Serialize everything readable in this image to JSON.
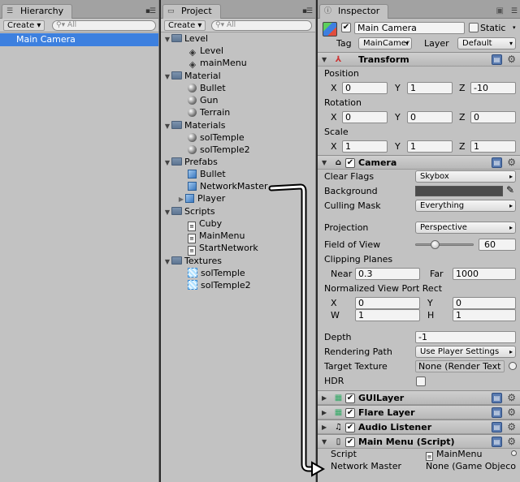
{
  "hierarchy": {
    "tab_label": "Hierarchy",
    "create_label": "Create ▾",
    "search_placeholder": "All",
    "items": [
      "Main Camera"
    ]
  },
  "project": {
    "tab_label": "Project",
    "create_label": "Create ▾",
    "search_placeholder": "All",
    "tree": {
      "level_folder": "Level",
      "level_items": [
        "Level",
        "mainMenu"
      ],
      "material_folder": "Material",
      "material_items": [
        "Bullet",
        "Gun",
        "Terrain"
      ],
      "materials_folder": "Materials",
      "materials_items": [
        "solTemple",
        "solTemple2"
      ],
      "prefabs_folder": "Prefabs",
      "prefabs_items": [
        "Bullet",
        "NetworkMaster",
        "Player"
      ],
      "scripts_folder": "Scripts",
      "scripts_items": [
        "Cuby",
        "MainMenu",
        "StartNetwork"
      ],
      "textures_folder": "Textures",
      "textures_items": [
        "solTemple",
        "solTemple2"
      ]
    }
  },
  "inspector": {
    "tab_label": "Inspector",
    "object_name": "Main Camera",
    "static_label": "Static",
    "tag_label": "Tag",
    "tag_value": "MainCamer",
    "layer_label": "Layer",
    "layer_value": "Default",
    "transform": {
      "title": "Transform",
      "position_label": "Position",
      "position": {
        "x": "0",
        "y": "1",
        "z": "-10"
      },
      "rotation_label": "Rotation",
      "rotation": {
        "x": "0",
        "y": "0",
        "z": "0"
      },
      "scale_label": "Scale",
      "scale": {
        "x": "1",
        "y": "1",
        "z": "1"
      },
      "x_label": "X",
      "y_label": "Y",
      "z_label": "Z"
    },
    "camera": {
      "title": "Camera",
      "clear_flags_label": "Clear Flags",
      "clear_flags_value": "Skybox",
      "background_label": "Background",
      "background_color": "#4b4b4b",
      "culling_mask_label": "Culling Mask",
      "culling_mask_value": "Everything",
      "projection_label": "Projection",
      "projection_value": "Perspective",
      "fov_label": "Field of View",
      "fov_value": "60",
      "fov_fraction": 0.34,
      "clipping_label": "Clipping Planes",
      "near_label": "Near",
      "near_value": "0.3",
      "far_label": "Far",
      "far_value": "1000",
      "viewport_label": "Normalized View Port Rect",
      "vp_x_label": "X",
      "vp_x": "0",
      "vp_y_label": "Y",
      "vp_y": "0",
      "vp_w_label": "W",
      "vp_w": "1",
      "vp_h_label": "H",
      "vp_h": "1",
      "depth_label": "Depth",
      "depth_value": "-1",
      "rendering_path_label": "Rendering Path",
      "rendering_path_value": "Use Player Settings",
      "target_texture_label": "Target Texture",
      "target_texture_value": "None (Render Text",
      "hdr_label": "HDR"
    },
    "guilayer_title": "GUILayer",
    "flarelayer_title": "Flare Layer",
    "audiolistener_title": "Audio Listener",
    "mainmenu": {
      "title": "Main Menu (Script)",
      "script_label": "Script",
      "script_value": "MainMenu",
      "network_master_label": "Network Master",
      "network_master_value": "None (Game Objeco"
    }
  },
  "colors": {
    "selection": "#3d80df",
    "panel": "#c2c2c2"
  }
}
